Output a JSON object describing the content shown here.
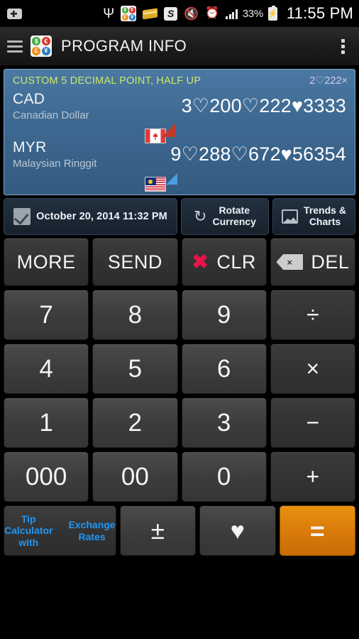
{
  "statusbar": {
    "download_icon": "download-badge-icon",
    "usb_icon": "usb-icon",
    "app_icon": "currency-app-icon",
    "book_icon": "book-icon",
    "s_icon": "s-app-icon",
    "mute_icon": "vibrate-mute-icon",
    "alarm_icon": "alarm-clock-icon",
    "signal_icon": "signal-bars-icon",
    "battery_percent": "33%",
    "battery_icon": "battery-charging-icon",
    "time": "11:55 PM"
  },
  "actionbar": {
    "menu_icon": "hamburger-menu-icon",
    "app_icon": "currency-app-icon",
    "title": "PROGRAM INFO",
    "overflow_icon": "overflow-menu-icon",
    "app_icon_symbols": [
      "$",
      "€",
      "£",
      "¥"
    ]
  },
  "display": {
    "mode_label": "CUSTOM",
    "mode_detail": "5 DECIMAL POINT, HALF UP",
    "multiplier": "2♡222×",
    "accent_green": "#cbe86b",
    "accent_lavender": "#d6c7e8",
    "panel_color": "#3f6b93",
    "rows": [
      {
        "code": "CAD",
        "name": "Canadian Dollar",
        "flag": "canada-flag-icon",
        "amount": "3♡200♡222♥3333",
        "marker": "red-triangle-marker",
        "marker_color": "#c0392b"
      },
      {
        "code": "MYR",
        "name": "Malaysian Ringgit",
        "flag": "malaysia-flag-icon",
        "amount": "9♡288♡672♥56354",
        "marker": "blue-triangle-marker",
        "marker_color": "#4a9fe0"
      }
    ]
  },
  "inforow": {
    "date_icon": "checkmark-icon",
    "date_text": "October 20, 2014 11:32 PM",
    "rotate_icon": "rotate-refresh-icon",
    "rotate_line1": "Rotate",
    "rotate_line2": "Currency",
    "trends_icon": "image-picture-icon",
    "trends_line1": "Trends &",
    "trends_line2": "Charts"
  },
  "keypad": {
    "functions": {
      "more": "MORE",
      "send": "SEND",
      "clear_icon": "red-x-icon",
      "clear": "CLR",
      "delete_icon": "backspace-icon",
      "delete": "DEL"
    },
    "rows": [
      [
        "7",
        "8",
        "9",
        "÷"
      ],
      [
        "4",
        "5",
        "6",
        "×"
      ],
      [
        "1",
        "2",
        "3",
        "−"
      ],
      [
        "000",
        "00",
        "0",
        "+"
      ]
    ],
    "bottom": {
      "tip_line1": "Tip Calculator with",
      "tip_line2": "Exchange Rates",
      "tip_color": "#2196f3",
      "sign_toggle": "±",
      "favorite_icon": "heart-icon",
      "favorite": "♥",
      "equals": "=",
      "equals_color": "#d9790a"
    }
  }
}
